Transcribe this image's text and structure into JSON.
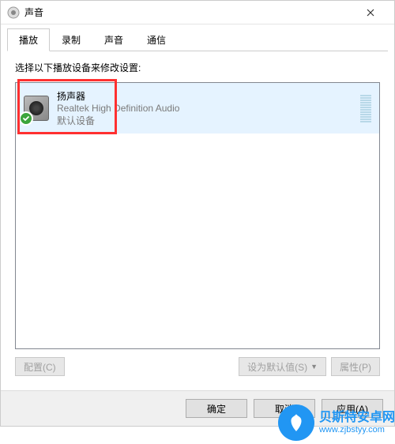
{
  "window": {
    "title": "声音"
  },
  "tabs": [
    {
      "label": "播放",
      "active": true
    },
    {
      "label": "录制",
      "active": false
    },
    {
      "label": "声音",
      "active": false
    },
    {
      "label": "通信",
      "active": false
    }
  ],
  "prompt": "选择以下播放设备来修改设置:",
  "device": {
    "name": "扬声器",
    "description": "Realtek High Definition Audio",
    "status": "默认设备"
  },
  "lower_buttons": {
    "configure": "配置(C)",
    "set_default": "设为默认值(S)",
    "properties": "属性(P)"
  },
  "dialog_buttons": {
    "ok": "确定",
    "cancel": "取消",
    "apply": "应用(A)"
  },
  "watermark": {
    "line1": "贝斯特安卓网",
    "line2": "www.zjbstyy.com"
  }
}
